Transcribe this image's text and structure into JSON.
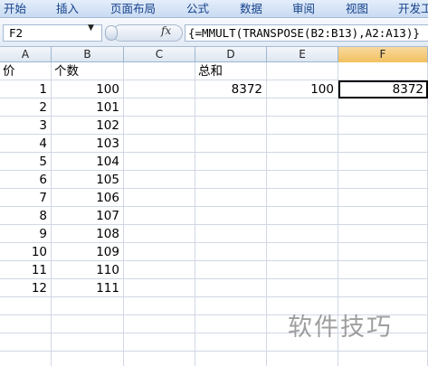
{
  "ribbon": {
    "tabs": [
      "开始",
      "插入",
      "页面布局",
      "公式",
      "数据",
      "审阅",
      "视图",
      "开发工"
    ]
  },
  "formula_bar": {
    "name_box": "F2",
    "fx_label": "fx",
    "formula": "{=MMULT(TRANSPOSE(B2:B13),A2:A13)}"
  },
  "columns": [
    "A",
    "B",
    "C",
    "D",
    "E",
    "F"
  ],
  "selected_column": "F",
  "header_row": {
    "a": "价",
    "b": "个数",
    "d": "总和"
  },
  "rows": [
    {
      "a": "1",
      "b": "100",
      "d": "8372",
      "e": "100",
      "f": "8372"
    },
    {
      "a": "2",
      "b": "101"
    },
    {
      "a": "3",
      "b": "102"
    },
    {
      "a": "4",
      "b": "103"
    },
    {
      "a": "5",
      "b": "104"
    },
    {
      "a": "6",
      "b": "105"
    },
    {
      "a": "7",
      "b": "106"
    },
    {
      "a": "8",
      "b": "107"
    },
    {
      "a": "9",
      "b": "108"
    },
    {
      "a": "10",
      "b": "109"
    },
    {
      "a": "11",
      "b": "110"
    },
    {
      "a": "12",
      "b": "111"
    }
  ],
  "watermark": "软件技巧"
}
